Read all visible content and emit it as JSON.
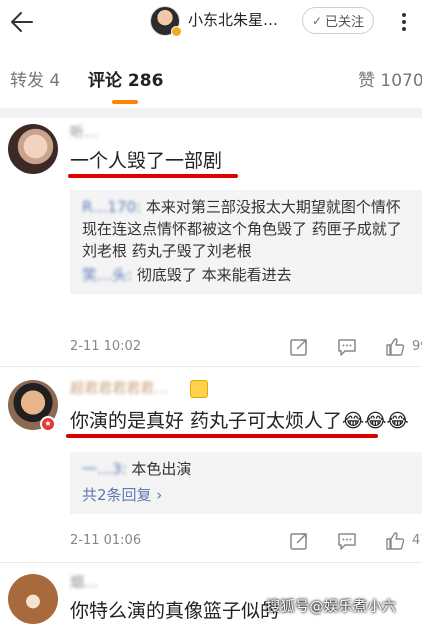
{
  "header": {
    "title": "小东北朱星…",
    "follow_label": "已关注",
    "follow_check": "✓"
  },
  "tabs": [
    {
      "label": "转发 4"
    },
    {
      "label": "评论 286"
    },
    {
      "label": "赞 1070"
    }
  ],
  "colors": {
    "accent": "#ff8200",
    "link": "#5b7bb5",
    "highlight": "#dd0000"
  },
  "comments": [
    {
      "username": "听…",
      "text": "一个人毁了一部剧",
      "replies": [
        {
          "name": "R…170:",
          "text": " 本来对第三部没报太大期望就图个情怀 现在连这点情怀都被这个角色毁了 药匣子成就了刘老根 药丸子毁了刘老根"
        },
        {
          "name": "笑…头:",
          "text": " 彻底毁了 本来能看进去"
        }
      ],
      "time": "2-11 10:02",
      "likes": "99"
    },
    {
      "username": "超君君君君君…",
      "text": "你演的是真好 药丸子可太烦人了😂😂😂",
      "replies": [
        {
          "name": "一…3:",
          "text": " 本色出演"
        }
      ],
      "more_replies": "共2条回复 ›",
      "time": "2-11 01:06",
      "likes": "41"
    },
    {
      "username": "烟…",
      "text": "你特么演的真像篮子似的"
    }
  ],
  "watermark": "搜狐号@娱乐煮小六"
}
